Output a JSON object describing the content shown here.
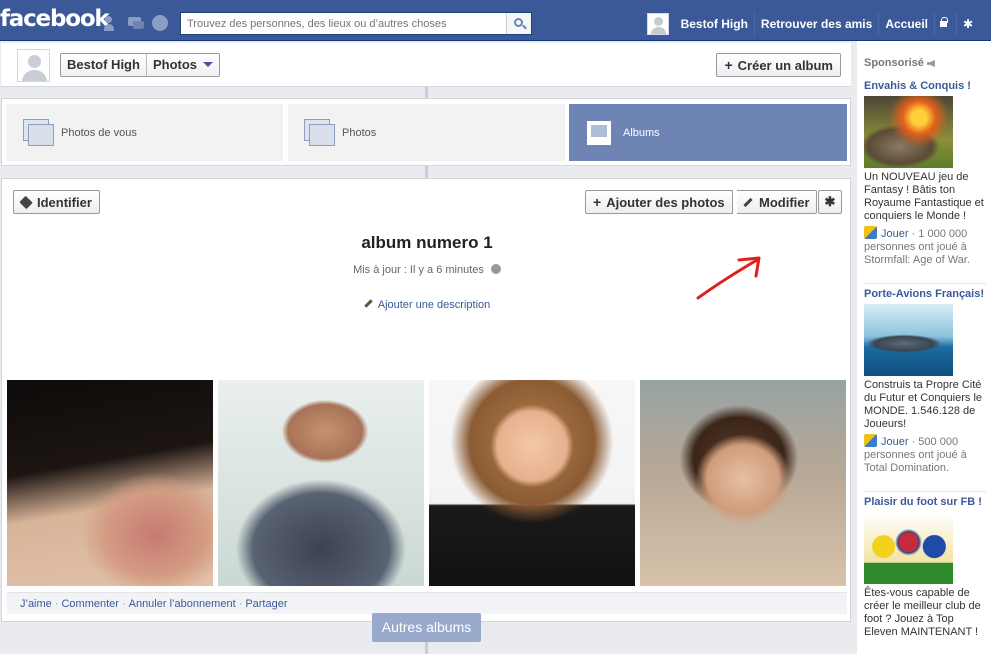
{
  "topbar": {
    "logo": "facebook",
    "search_placeholder": "Trouvez des personnes, des lieux ou d’autres choses",
    "user_name": "Bestof High",
    "find_friends": "Retrouver des amis",
    "home": "Accueil"
  },
  "header": {
    "breadcrumb_user": "Bestof High",
    "breadcrumb_section": "Photos",
    "create_album": "Créer un album"
  },
  "tabs": [
    {
      "label": "Photos de vous",
      "active": false
    },
    {
      "label": "Photos",
      "active": false
    },
    {
      "label": "Albums",
      "active": true
    }
  ],
  "album": {
    "identify": "Identifier",
    "add_photos": "Ajouter des photos",
    "edit": "Modifier",
    "title": "album numero 1",
    "updated": "Mis à jour : Il y a 6 minutes",
    "add_description": "Ajouter une description",
    "actions": [
      "J’aime",
      "Commenter",
      "Annuler l’abonnement",
      "Partager"
    ],
    "other_albums": "Autres albums"
  },
  "sidebar": {
    "sponsored": "Sponsorisé",
    "ads": [
      {
        "title": "Envahis & Conquis !",
        "body": "Un NOUVEAU jeu de Fantasy ! Bâtis ton Royaume Fantastique et conquiers le Monde !",
        "play": "Jouer",
        "social": " · 1 000 000 personnes ont joué à Stormfall: Age of War."
      },
      {
        "title": "Porte-Avions Français!",
        "body": "Construis ta Propre Cité du Futur et Conquiers le MONDE. 1.546.128 de Joueurs!",
        "play": "Jouer",
        "social": " · 500 000 personnes ont joué à Total Domination."
      },
      {
        "title": "Plaisir du foot sur FB !",
        "body": "Êtes-vous capable de créer le meilleur club de foot ? Jouez à Top Eleven MAINTENANT !"
      }
    ]
  },
  "colors": {
    "brand": "#3b5998",
    "active_tab": "#6d84b4",
    "annotation_arrow": "#e0201a"
  }
}
